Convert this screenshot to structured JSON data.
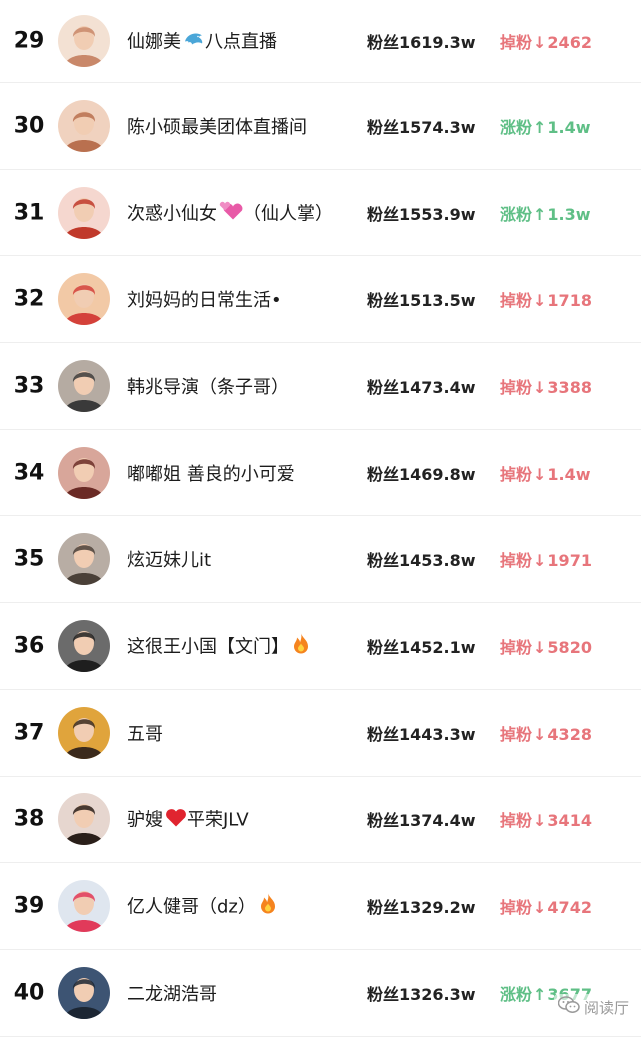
{
  "rows": [
    {
      "rank": "29",
      "name": "仙娜美",
      "emoji": "dolphin",
      "name_suffix": "八点直播",
      "fans": "粉丝1619.3w",
      "change_label": "掉粉",
      "change_dir": "down",
      "change_value": "2462",
      "avatar_color": "#c9886a",
      "avatar_bg": "#f3e1d3"
    },
    {
      "rank": "30",
      "name": "陈小硕最美团体直播间",
      "emoji": "",
      "name_suffix": "",
      "fans": "粉丝1574.3w",
      "change_label": "涨粉",
      "change_dir": "up",
      "change_value": "1.4w",
      "avatar_color": "#b9704f",
      "avatar_bg": "#f0d2bf"
    },
    {
      "rank": "31",
      "name": "次惑小仙女",
      "emoji": "hearts",
      "name_suffix": "（仙人掌）",
      "fans": "粉丝1553.9w",
      "change_label": "涨粉",
      "change_dir": "up",
      "change_value": "1.3w",
      "avatar_color": "#c0392b",
      "avatar_bg": "#f5d7cf"
    },
    {
      "rank": "32",
      "name": "刘妈妈的日常生活•",
      "emoji": "",
      "name_suffix": "",
      "fans": "粉丝1513.5w",
      "change_label": "掉粉",
      "change_dir": "down",
      "change_value": "1718",
      "avatar_color": "#d4413a",
      "avatar_bg": "#f2c9a6"
    },
    {
      "rank": "33",
      "name": "韩兆导演（条子哥）",
      "emoji": "",
      "name_suffix": "",
      "fans": "粉丝1473.4w",
      "change_label": "掉粉",
      "change_dir": "down",
      "change_value": "3388",
      "avatar_color": "#3a3a3a",
      "avatar_bg": "#b5aba2"
    },
    {
      "rank": "34",
      "name": "嘟嘟姐 善良的小可爱",
      "emoji": "",
      "name_suffix": "",
      "fans": "粉丝1469.8w",
      "change_label": "掉粉",
      "change_dir": "down",
      "change_value": "1.4w",
      "avatar_color": "#6a2a25",
      "avatar_bg": "#d8a69a"
    },
    {
      "rank": "35",
      "name": "炫迈妹儿it",
      "emoji": "",
      "name_suffix": "",
      "fans": "粉丝1453.8w",
      "change_label": "掉粉",
      "change_dir": "down",
      "change_value": "1971",
      "avatar_color": "#4a4038",
      "avatar_bg": "#b8ada4"
    },
    {
      "rank": "36",
      "name": "这很王小国【文门】",
      "emoji": "fire",
      "name_suffix": "",
      "fans": "粉丝1452.1w",
      "change_label": "掉粉",
      "change_dir": "down",
      "change_value": "5820",
      "avatar_color": "#1e1e1e",
      "avatar_bg": "#6b6b6b"
    },
    {
      "rank": "37",
      "name": "五哥",
      "emoji": "",
      "name_suffix": "",
      "fans": "粉丝1443.3w",
      "change_label": "掉粉",
      "change_dir": "down",
      "change_value": "4328",
      "avatar_color": "#3b2a1c",
      "avatar_bg": "#e0a43c"
    },
    {
      "rank": "38",
      "name": "驴嫂",
      "emoji": "heart",
      "name_suffix": "平荣JLV",
      "fans": "粉丝1374.4w",
      "change_label": "掉粉",
      "change_dir": "down",
      "change_value": "3414",
      "avatar_color": "#2a1f1a",
      "avatar_bg": "#e6d6cf"
    },
    {
      "rank": "39",
      "name": "亿人健哥（dz）",
      "emoji": "fire",
      "name_suffix": "",
      "fans": "粉丝1329.2w",
      "change_label": "掉粉",
      "change_dir": "down",
      "change_value": "4742",
      "avatar_color": "#e13a5a",
      "avatar_bg": "#dfe6ef"
    },
    {
      "rank": "40",
      "name": "二龙湖浩哥",
      "emoji": "",
      "name_suffix": "",
      "fans": "粉丝1326.3w",
      "change_label": "涨粉",
      "change_dir": "up",
      "change_value": "3677",
      "avatar_color": "#1c2633",
      "avatar_bg": "#3d5473"
    }
  ],
  "arrows": {
    "up": "↑",
    "down": "↓"
  },
  "watermark": {
    "text": "阅读厅",
    "icon": "wechat-icon"
  }
}
